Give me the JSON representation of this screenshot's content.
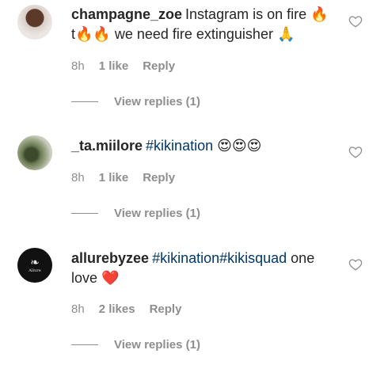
{
  "comments": [
    {
      "username": "champagne_zoe",
      "text_parts": [
        {
          "type": "text",
          "value": "Instagram is on fire 🔥 t🔥🔥 we need fire extinguisher 🙏"
        }
      ],
      "time": "8h",
      "likes": "1 like",
      "reply": "Reply",
      "view_replies": "View replies (1)",
      "avatar": "user-photo-avatar"
    },
    {
      "username": "_ta.miilore",
      "text_parts": [
        {
          "type": "tag",
          "value": "#kikination"
        },
        {
          "type": "text",
          "value": " 😍😍😍"
        }
      ],
      "time": "8h",
      "likes": "1 like",
      "reply": "Reply",
      "view_replies": "View replies (1)",
      "avatar": "user-photo-avatar"
    },
    {
      "username": "allurebyzee",
      "text_parts": [
        {
          "type": "tag",
          "value": "#kikination#kikisquad"
        },
        {
          "type": "text",
          "value": " one love ❤️"
        }
      ],
      "time": "8h",
      "likes": "2 likes",
      "reply": "Reply",
      "view_replies": "View replies (1)",
      "avatar": "brand-logo-avatar",
      "avatar_logo_text": "Allure"
    }
  ],
  "colors": {
    "text": "#262626",
    "secondary": "#8e8e8e",
    "hashtag": "#00376b"
  },
  "icons": {
    "like": "heart-outline-icon"
  }
}
